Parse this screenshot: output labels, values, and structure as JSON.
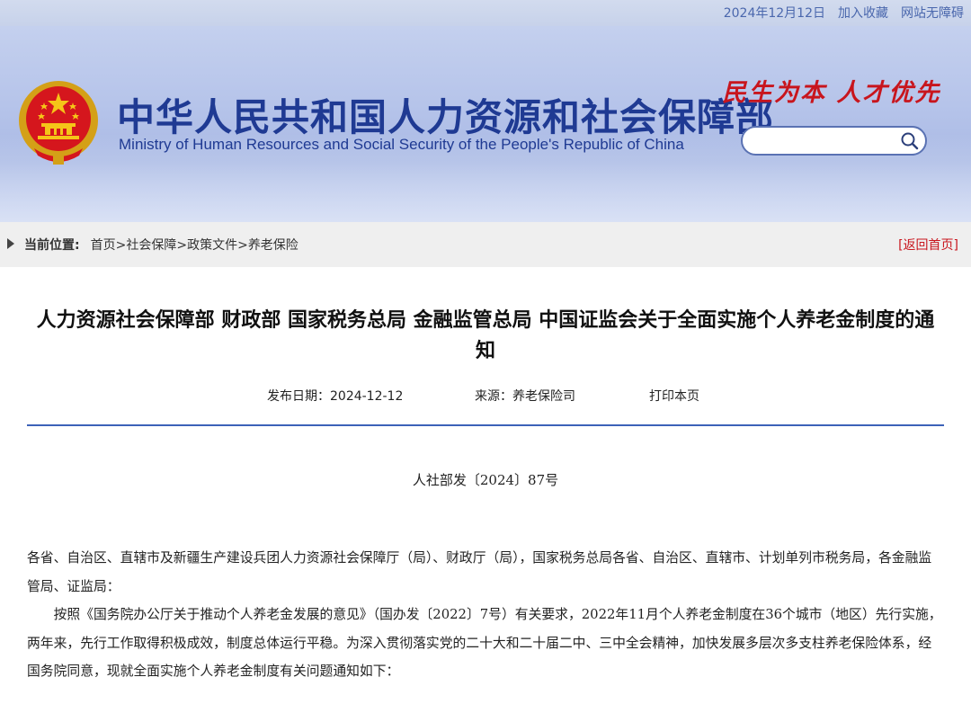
{
  "topbar": {
    "date": "2024年12月12日",
    "favorite_label": "加入收藏",
    "accessible_label": "网站无障碍"
  },
  "header": {
    "title_cn": "中华人民共和国人力资源和社会保障部",
    "title_en": "Ministry of Human Resources and Social Security of the People's Republic of China",
    "slogan": "民生为本 人才优先",
    "search": {
      "placeholder": "",
      "value": "",
      "icon": "search-icon"
    }
  },
  "breadcrumb": {
    "label": "当前位置:",
    "items": [
      "首页",
      "社会保障",
      "政策文件",
      "养老保险"
    ],
    "separator": ">",
    "back_label": "[返回首页]"
  },
  "article": {
    "title": "人力资源社会保障部 财政部 国家税务总局 金融监管总局 中国证监会关于全面实施个人养老金制度的通知",
    "pub_date": "发布日期：2024-12-12",
    "source": "来源：养老保险司",
    "print_label": "打印本页",
    "doc_no": "人社部发〔2024〕87号",
    "paragraphs": [
      "各省、自治区、直辖市及新疆生产建设兵团人力资源社会保障厅（局）、财政厅（局），国家税务总局各省、自治区、直辖市、计划单列市税务局，各金融监管局、证监局：",
      "按照《国务院办公厅关于推动个人养老金发展的意见》（国办发〔2022〕7号）有关要求，2022年11月个人养老金制度在36个城市（地区）先行实施，两年来，先行工作取得积极成效，制度总体运行平稳。为深入贯彻落实党的二十大和二十届二中、三中全会精神，加快发展多层次多支柱养老保险体系，经国务院同意，现就全面实施个人养老金制度有关问题通知如下："
    ]
  },
  "colors": {
    "brand_blue": "#1f3a93",
    "slogan_red": "#c8151d",
    "divider_blue": "#3d62b8"
  }
}
